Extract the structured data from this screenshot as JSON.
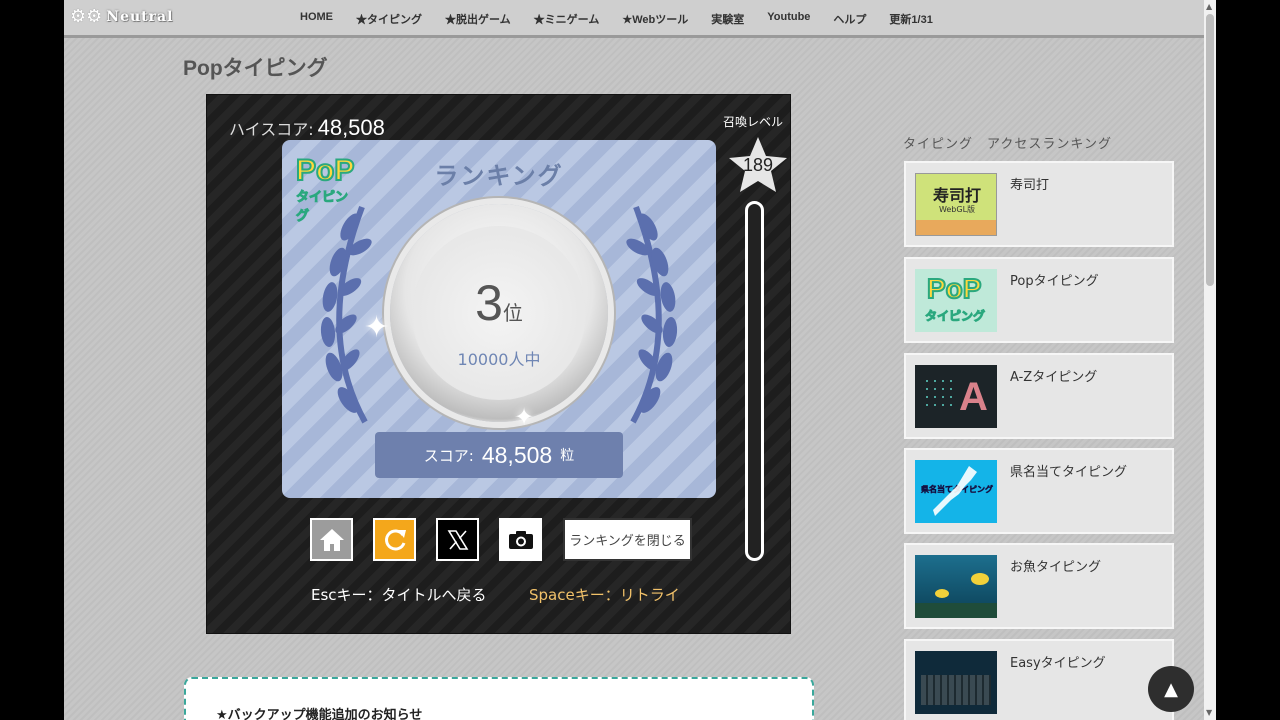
{
  "logo": {
    "text": "Neutral"
  },
  "nav": [
    "HOME",
    "★タイピング",
    "★脱出ゲーム",
    "★ミニゲーム",
    "★Webツール",
    "実験室",
    "Youtube",
    "ヘルプ",
    "更新1/31"
  ],
  "page_title": "Popタイピング",
  "game": {
    "hiscore_label": "ハイスコア:",
    "hiscore_value": "48,508",
    "summon_label": "召喚レベル",
    "summon_level": "189",
    "panel_title": "ランキング",
    "logo_top": "PoP",
    "logo_bottom": "タイピング",
    "rank_number": "3",
    "rank_unit": "位",
    "rank_total": "10000人中",
    "score_label": "スコア:",
    "score_value": "48,508",
    "score_unit": "粒",
    "close_ranking_label": "ランキングを閉じる",
    "hint_esc": "Escキー：タイトルへ戻る",
    "hint_space": "Spaceキー：リトライ",
    "gauge_fill_fraction": 0
  },
  "notice": {
    "link": "★バックアップ機能追加のお知らせ"
  },
  "sidebar": {
    "heading": "タイピング　アクセスランキング",
    "items": [
      {
        "title": "寿司打",
        "thumb_text": "寿司打",
        "thumb_sub": "WebGL版"
      },
      {
        "title": "Popタイピング",
        "thumb_text": "PoP",
        "thumb_sub": "タイピング"
      },
      {
        "title": "A-Zタイピング",
        "thumb_text": "A"
      },
      {
        "title": "県名当てタイピング",
        "thumb_text": "県名当てタイピング"
      },
      {
        "title": "お魚タイピング"
      },
      {
        "title": "Easyタイピング"
      }
    ]
  },
  "colors": {
    "accent_teal": "#3aa79b",
    "retry_orange": "#f4a71b",
    "panel_blue": "#6e80ad"
  }
}
